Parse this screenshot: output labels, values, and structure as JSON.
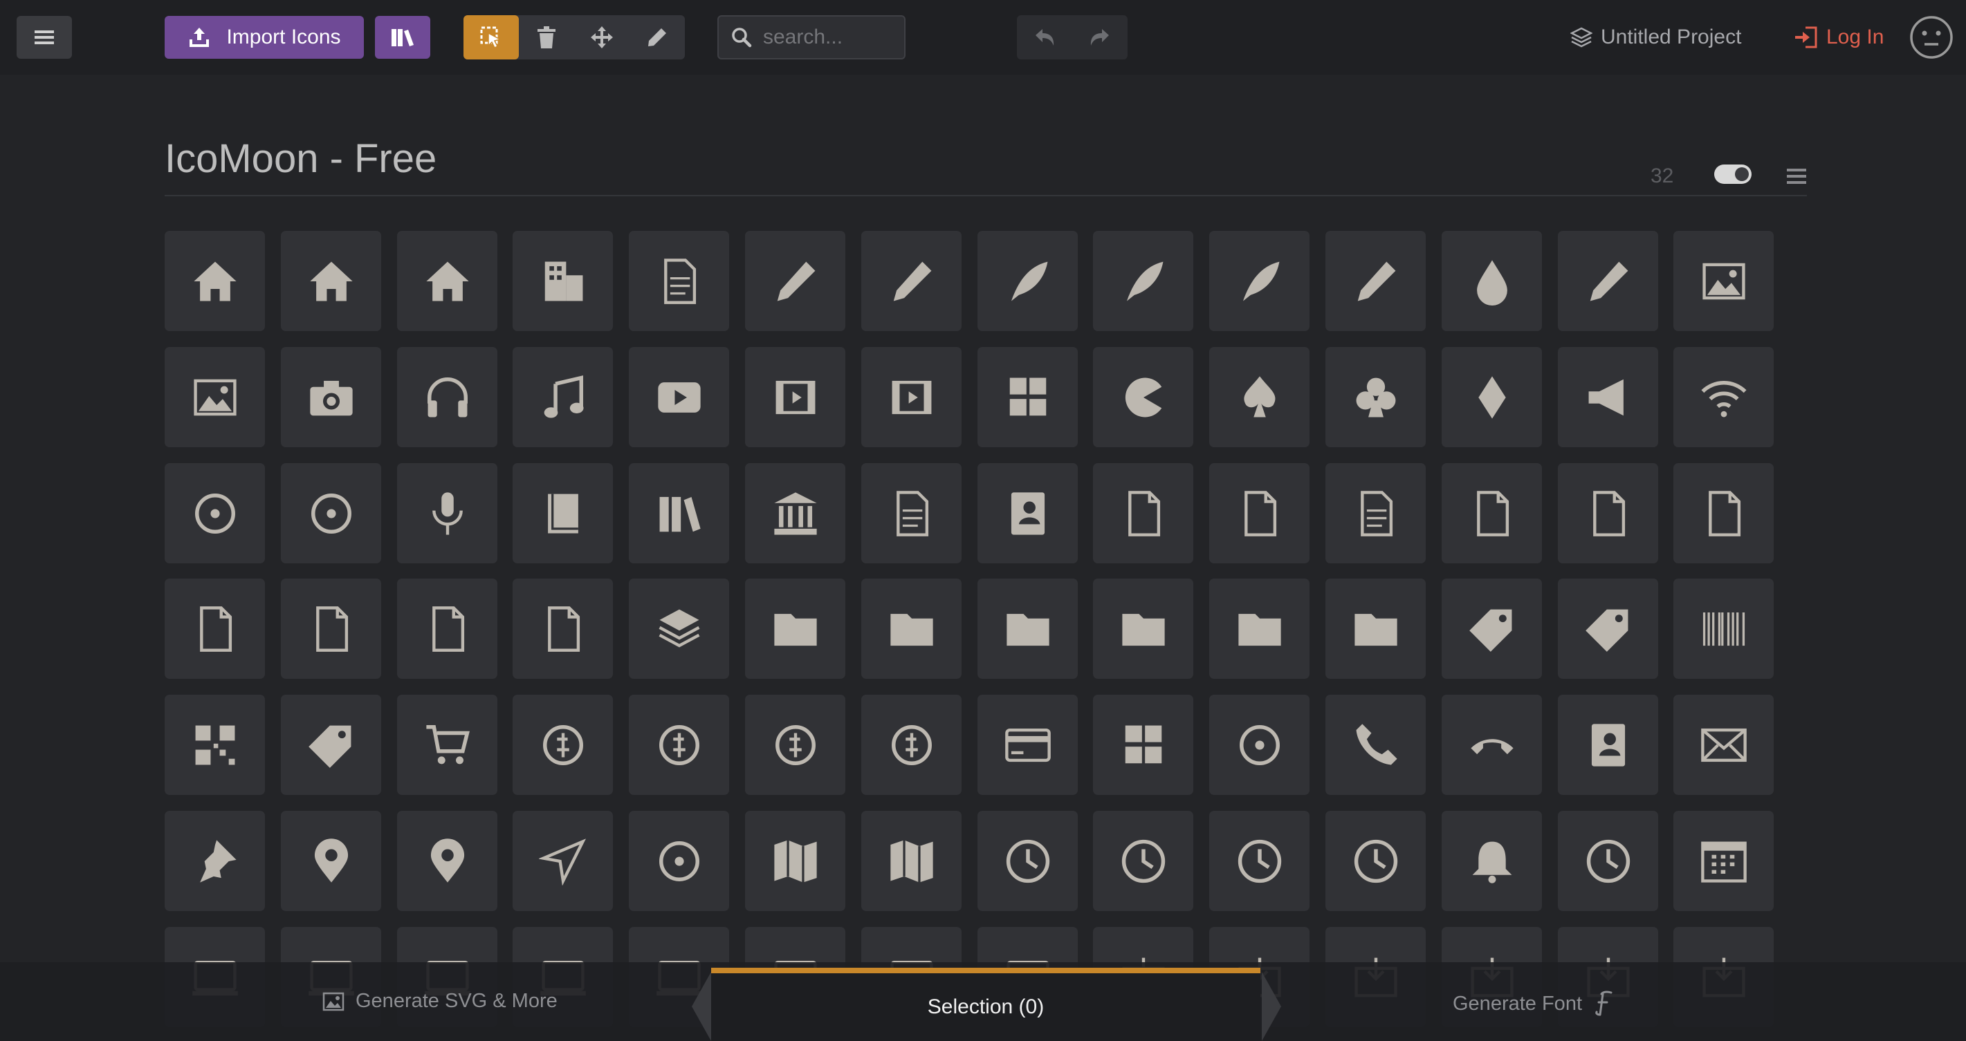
{
  "toolbar": {
    "import_label": "Import Icons",
    "search_placeholder": "search...",
    "project_name": "Untitled Project",
    "login_label": "Log In",
    "tools": [
      {
        "name": "select-tool",
        "icon": "cursor-select-icon",
        "active": true
      },
      {
        "name": "delete-tool",
        "icon": "trash-icon",
        "active": false
      },
      {
        "name": "move-tool",
        "icon": "move-icon",
        "active": false
      },
      {
        "name": "edit-tool",
        "icon": "pencil-icon",
        "active": false
      }
    ]
  },
  "icon_set": {
    "title": "IcoMoon - Free",
    "size": "32"
  },
  "icons": [
    [
      "home",
      "home2",
      "home3",
      "office",
      "newspaper",
      "pencil",
      "pencil2",
      "quill",
      "pen",
      "blog",
      "eyedropper",
      "droplet",
      "paint-format",
      "image"
    ],
    [
      "images",
      "camera",
      "headphones",
      "music",
      "play",
      "film",
      "video-camera",
      "dice",
      "pacman",
      "spades",
      "clubs",
      "diamonds",
      "bullhorn",
      "connection"
    ],
    [
      "podcast",
      "feed",
      "mic",
      "book",
      "books",
      "library",
      "file-text",
      "profile",
      "file-empty",
      "files-empty",
      "file-text2",
      "file-picture",
      "file-music",
      "file-play"
    ],
    [
      "file-video",
      "file-zip",
      "copy",
      "paste",
      "stack",
      "folder",
      "folder-open",
      "folder-plus",
      "folder-minus",
      "folder-download",
      "folder-upload",
      "price-tag",
      "price-tags",
      "barcode"
    ],
    [
      "qrcode",
      "ticket",
      "cart",
      "coin-dollar",
      "coin-euro",
      "coin-pound",
      "coin-yen",
      "credit-card",
      "calculator",
      "lifebuoy",
      "phone",
      "phone-hang-up",
      "address-book",
      "envelop"
    ],
    [
      "pushpin",
      "location",
      "location2",
      "compass",
      "compass2",
      "map",
      "map2",
      "history",
      "clock",
      "clock2",
      "alarm",
      "bell",
      "stopwatch",
      "calendar"
    ],
    [
      "printer",
      "keyboard",
      "display",
      "laptop",
      "mobile",
      "mobile2",
      "tablet",
      "tv",
      "drawer",
      "drawer2",
      "box-add",
      "box-remove",
      "download",
      "upload"
    ]
  ],
  "bottom_bar": {
    "generate_svg_label": "Generate SVG & More",
    "selection_label": "Selection (0)",
    "generate_font_label": "Generate Font"
  },
  "colors": {
    "accent": "#c9882a",
    "brand_purple": "#6f4a96",
    "login_red": "#e0604e",
    "icon_fill": "#bdb8b0"
  }
}
